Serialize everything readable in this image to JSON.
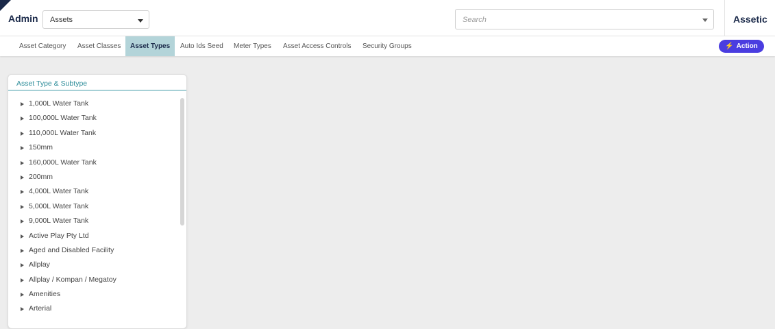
{
  "header": {
    "admin_label": "Admin",
    "module_select": {
      "value": "Assets"
    },
    "search": {
      "placeholder": "Search"
    },
    "brand": "Assetic"
  },
  "tabs": [
    {
      "label": "Asset Category",
      "active": false
    },
    {
      "label": "Asset Classes",
      "active": false
    },
    {
      "label": "Asset Types",
      "active": true
    },
    {
      "label": "Auto Ids Seed",
      "active": false
    },
    {
      "label": "Meter Types",
      "active": false
    },
    {
      "label": "Asset Access Controls",
      "active": false
    },
    {
      "label": "Security Groups",
      "active": false
    }
  ],
  "action_button": {
    "label": "Action",
    "icon": "lightning-bolt-icon",
    "color": "#4a3de0"
  },
  "panel": {
    "title": "Asset Type & Subtype",
    "items": [
      "1,000L Water Tank",
      "100,000L Water Tank",
      "110,000L Water Tank",
      "150mm",
      "160,000L Water Tank",
      "200mm",
      "4,000L Water Tank",
      "5,000L Water Tank",
      "9,000L Water Tank",
      "Active Play Pty Ltd",
      "Aged and Disabled Facility",
      "Allplay",
      "Allplay / Kompan / Megatoy",
      "Amenities",
      "Arterial"
    ]
  },
  "colors": {
    "accent_teal": "#2e8d9a",
    "active_tab_bg": "#b3d4d9",
    "brand_navy": "#1b2a4a"
  }
}
